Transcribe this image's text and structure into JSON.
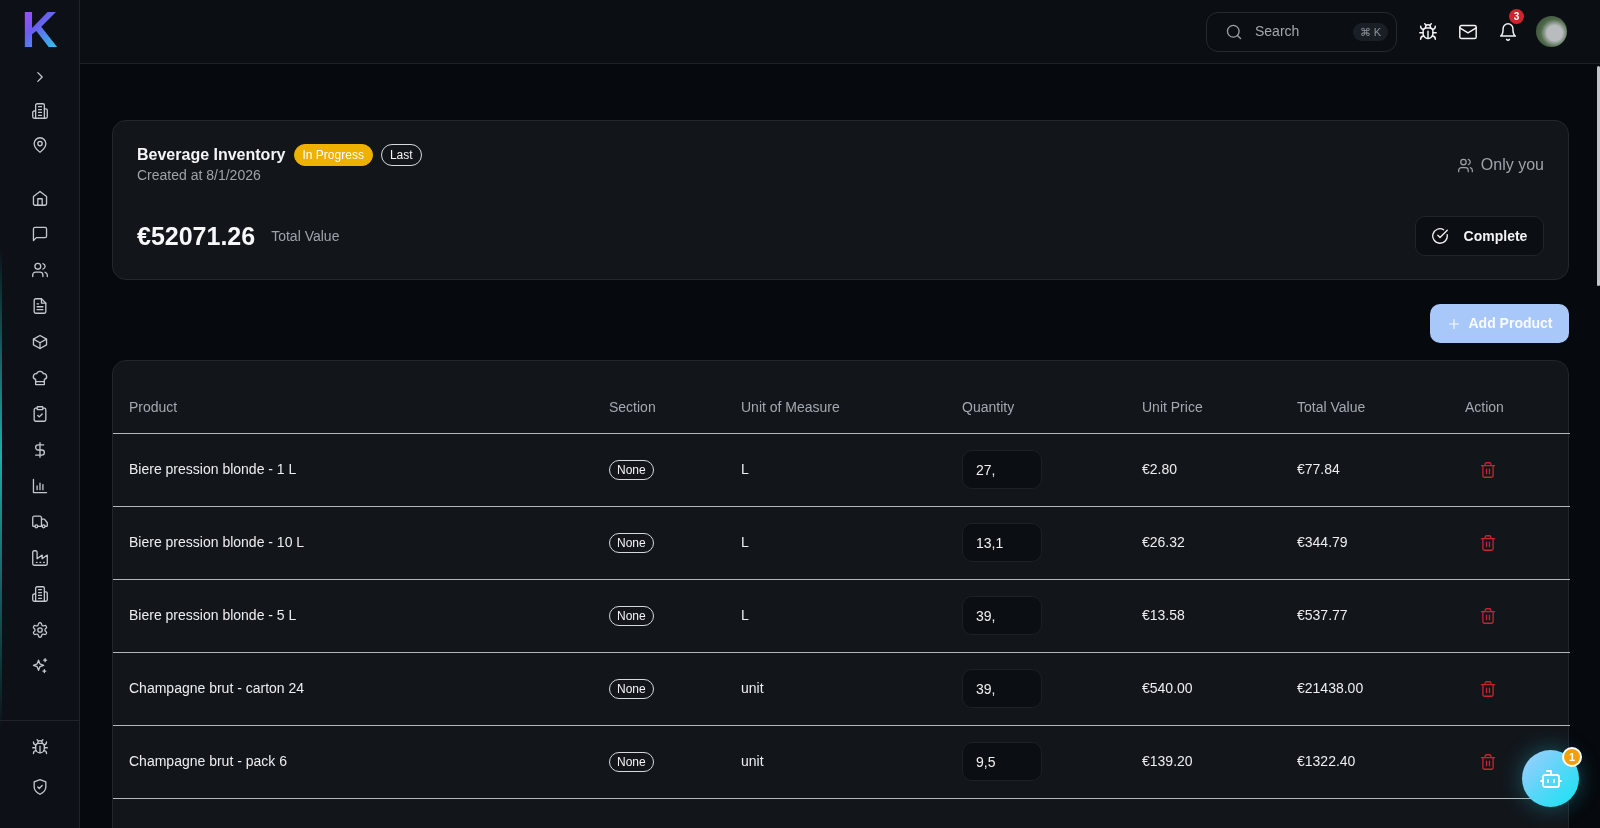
{
  "brand": {
    "logo": "K"
  },
  "top_bar": {
    "search": {
      "placeholder": "Search",
      "shortcut": "⌘ K"
    },
    "notification_count": "3"
  },
  "inventory": {
    "title": "Beverage Inventory",
    "tags": [
      {
        "label": "In Progress",
        "kind": "status"
      },
      {
        "label": "Last",
        "kind": "outline"
      }
    ],
    "created": "Created at 8/1/2026",
    "visibility": "Only you",
    "total_value": "€52071.26",
    "total_label": "Total Value",
    "complete_button": "Complete"
  },
  "add_product_button": "Add Product",
  "table": {
    "columns": [
      "Product",
      "Section",
      "Unit of Measure",
      "Quantity",
      "Unit Price",
      "Total Value",
      "Action"
    ],
    "rows": [
      {
        "product": "Biere pression blonde - 1 L",
        "section": "None",
        "unit": "L",
        "quantity": "27,",
        "unit_price": "€2.80",
        "total_value": "€77.84"
      },
      {
        "product": "Biere pression blonde - 10 L",
        "section": "None",
        "unit": "L",
        "quantity": "13,1",
        "unit_price": "€26.32",
        "total_value": "€344.79"
      },
      {
        "product": "Biere pression blonde - 5 L",
        "section": "None",
        "unit": "L",
        "quantity": "39,",
        "unit_price": "€13.58",
        "total_value": "€537.77"
      },
      {
        "product": "Champagne brut - carton 24",
        "section": "None",
        "unit": "unit",
        "quantity": "39,",
        "unit_price": "€540.00",
        "total_value": "€21438.00"
      },
      {
        "product": "Champagne brut - pack 6",
        "section": "None",
        "unit": "unit",
        "quantity": "9,5",
        "unit_price": "€139.20",
        "total_value": "€1322.40"
      }
    ]
  },
  "assistant": {
    "badge": "1"
  }
}
